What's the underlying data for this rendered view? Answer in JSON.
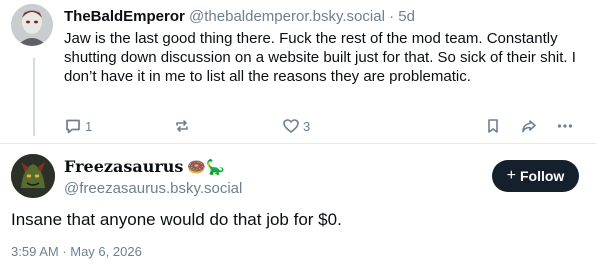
{
  "parent_post": {
    "author_name": "TheBaldEmperor",
    "handle": "@thebaldemperor.bsky.social",
    "separator": "·",
    "age": "5d",
    "text": "Jaw is the last good thing there. Fuck the rest of the mod team. Constantly shutting down discussion on a website built just for that. So sick of their shit. I don’t have it in me to list all the reasons they are problematic.",
    "reply_count": "1",
    "like_count": "3"
  },
  "main_post": {
    "author_name": "Freezasaurus",
    "author_emojis": "🍩🦕",
    "handle": "@freezasaurus.bsky.social",
    "follow_icon": "+",
    "follow_label": "Follow",
    "text": "Insane that anyone would do that job for $0.",
    "timestamp": "3:59 AM · May 6, 2026"
  },
  "colors": {
    "text": "#0b0f14",
    "muted": "#6f7f90",
    "follow_bg": "#16202c",
    "divider": "#e6eaee"
  }
}
